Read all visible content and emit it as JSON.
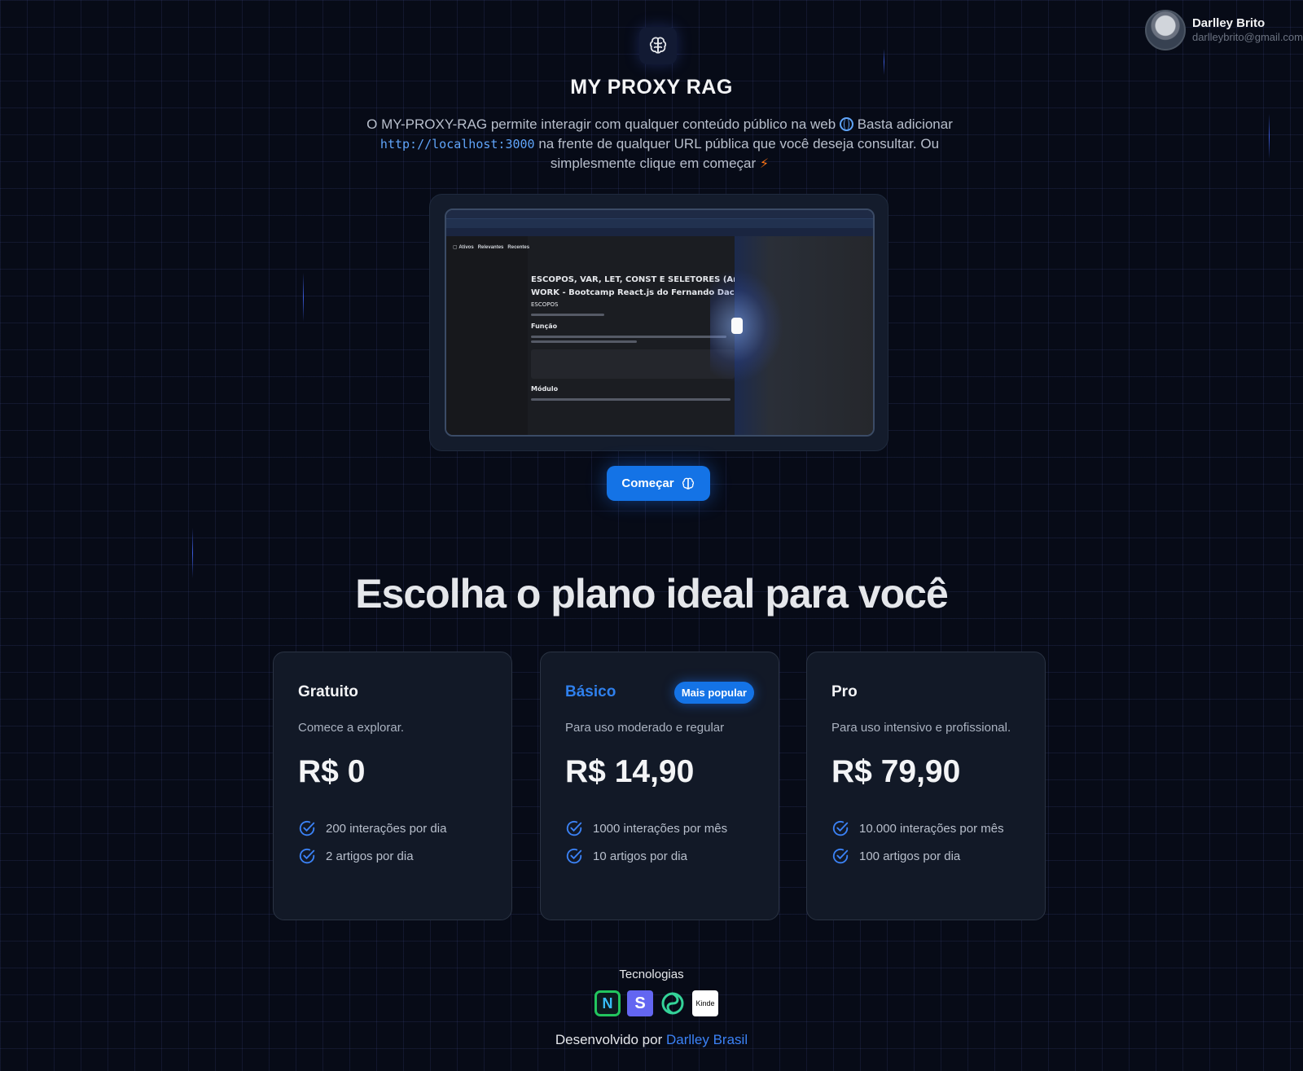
{
  "user": {
    "name": "Darlley Brito",
    "email": "darlleybrito@gmail.com"
  },
  "hero": {
    "title": "MY PROXY RAG",
    "intro_part1": "O MY-PROXY-RAG permite interagir com qualquer conteúdo público na web",
    "intro_part2": "Basta adicionar",
    "code": "http://localhost:3000",
    "intro_part3": "na frente de qualquer URL pública que você deseja consultar. Ou simplesmente clique em começar",
    "start_button": "Começar"
  },
  "preview": {
    "nav_items": [
      "Ativos",
      "Relevantes",
      "Recentes"
    ],
    "heading_line1": "ESCOPOS, VAR, LET, CONST E SELETORES (Anotac",
    "heading_line2": "WORK - Bootcamp React.js do Fernando Daciuk)",
    "subheading": "ESCOPOS",
    "section1": "Função",
    "section2": "Módulo"
  },
  "plans": {
    "title": "Escolha o plano ideal para você",
    "items": [
      {
        "name": "Gratuito",
        "badge": "",
        "description": "Comece a explorar.",
        "price": "R$ 0",
        "features": [
          "200 interações por dia",
          "2 artigos por dia"
        ]
      },
      {
        "name": "Básico",
        "badge": "Mais popular",
        "description": "Para uso moderado e regular",
        "price": "R$ 14,90",
        "features": [
          "1000 interações por mês",
          "10 artigos por dia"
        ]
      },
      {
        "name": "Pro",
        "badge": "",
        "description": "Para uso intensivo e profissional.",
        "price": "R$ 79,90",
        "features": [
          "10.000 interações por mês",
          "100 artigos por dia"
        ]
      }
    ]
  },
  "footer": {
    "tech_label": "Tecnologias",
    "tech": [
      {
        "icon": "nextjs-icon",
        "glyph": "N"
      },
      {
        "icon": "stripe-icon",
        "glyph": "S"
      },
      {
        "icon": "openai-icon",
        "glyph": ""
      },
      {
        "icon": "kinde-icon",
        "glyph": "Kinde"
      }
    ],
    "credit_prefix": "Desenvolvido por",
    "credit_link": "Darlley Brasil"
  },
  "colors": {
    "accent": "#1473e6",
    "background": "#070b17",
    "card": "#121927"
  }
}
